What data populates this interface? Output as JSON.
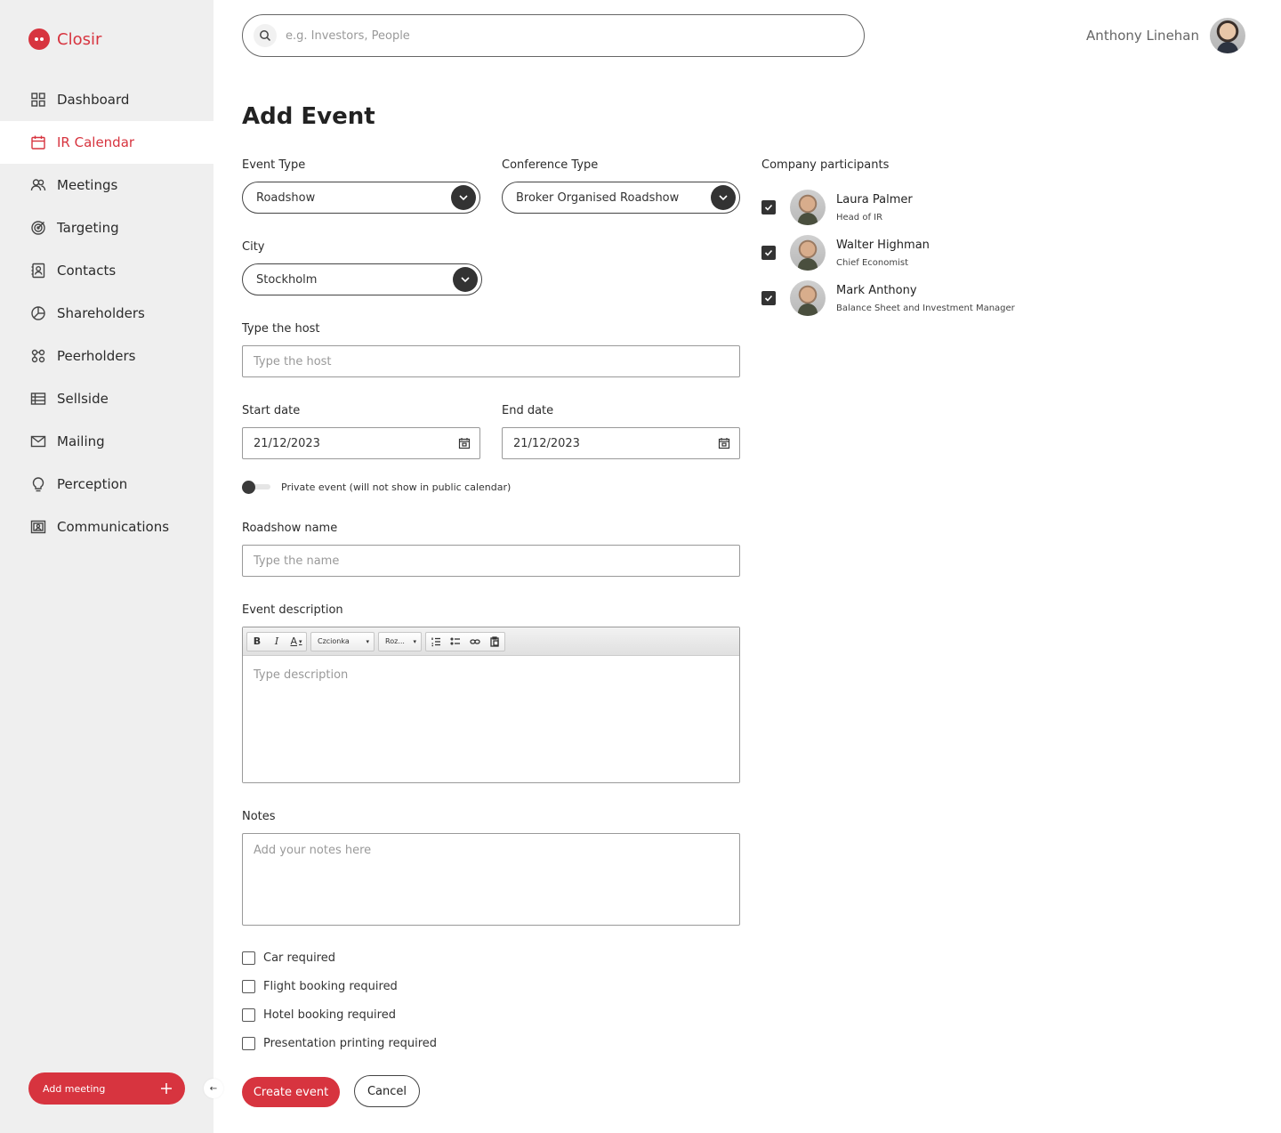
{
  "brand": {
    "name": "Closir"
  },
  "sidebar": {
    "items": [
      {
        "label": "Dashboard",
        "icon": "grid-icon"
      },
      {
        "label": "IR Calendar",
        "icon": "calendar-icon",
        "active": true
      },
      {
        "label": "Meetings",
        "icon": "users-icon"
      },
      {
        "label": "Targeting",
        "icon": "target-icon"
      },
      {
        "label": "Contacts",
        "icon": "contact-card-icon"
      },
      {
        "label": "Shareholders",
        "icon": "pie-chart-icon"
      },
      {
        "label": "Peerholders",
        "icon": "network-icon"
      },
      {
        "label": "Sellside",
        "icon": "table-icon"
      },
      {
        "label": "Mailing",
        "icon": "mail-icon"
      },
      {
        "label": "Perception",
        "icon": "lightbulb-icon"
      },
      {
        "label": "Communications",
        "icon": "presentation-icon"
      }
    ],
    "add_meeting_label": "Add meeting",
    "collapse_glyph": "←"
  },
  "header": {
    "search_placeholder": "e.g. Investors, People",
    "user_name": "Anthony Linehan"
  },
  "form": {
    "title": "Add Event",
    "event_type": {
      "label": "Event Type",
      "value": "Roadshow"
    },
    "conference_type": {
      "label": "Conference Type",
      "value": "Broker Organised Roadshow"
    },
    "city": {
      "label": "City",
      "value": "Stockholm"
    },
    "host": {
      "label": "Type the host",
      "placeholder": "Type the host"
    },
    "start_date": {
      "label": "Start date",
      "value": "21/12/2023"
    },
    "end_date": {
      "label": "End date",
      "value": "21/12/2023"
    },
    "private_toggle": {
      "label": "Private event (will not show in public calendar)",
      "on": false
    },
    "roadshow_name": {
      "label": "Roadshow name",
      "placeholder": "Type the name"
    },
    "description": {
      "label": "Event description",
      "placeholder": "Type description",
      "toolbar": {
        "bold": "B",
        "italic": "I",
        "font_color": "A",
        "font_combo": "Czcionka",
        "size_combo": "Roz..."
      }
    },
    "notes": {
      "label": "Notes",
      "placeholder": "Add your notes here"
    },
    "checkboxes": [
      {
        "label": "Car required",
        "checked": false
      },
      {
        "label": "Flight booking required",
        "checked": false
      },
      {
        "label": "Hotel booking required",
        "checked": false
      },
      {
        "label": "Presentation printing required",
        "checked": false
      }
    ],
    "create_button": "Create event",
    "cancel_button": "Cancel"
  },
  "participants": {
    "title": "Company participants",
    "items": [
      {
        "name": "Laura Palmer",
        "role": "Head of IR",
        "checked": true
      },
      {
        "name": "Walter Highman",
        "role": "Chief Economist",
        "checked": true
      },
      {
        "name": "Mark Anthony",
        "role": "Balance Sheet and Investment Manager",
        "checked": true
      }
    ]
  },
  "colors": {
    "accent": "#d7343f",
    "sidebar_bg": "#efefef",
    "dark": "#333333"
  }
}
